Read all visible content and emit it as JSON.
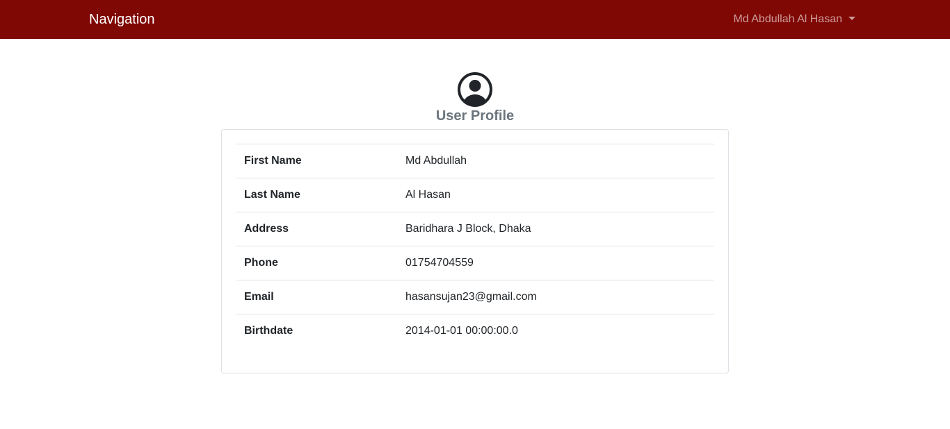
{
  "navbar": {
    "brand": "Navigation",
    "user_menu": "Md Abdullah Al Hasan",
    "background": "#7f0704"
  },
  "profile": {
    "icon": "user-circle-icon",
    "title": "User Profile",
    "rows": [
      {
        "label": "First Name",
        "value": "Md Abdullah"
      },
      {
        "label": "Last Name",
        "value": "Al Hasan"
      },
      {
        "label": "Address",
        "value": "Baridhara J Block, Dhaka"
      },
      {
        "label": "Phone",
        "value": "01754704559"
      },
      {
        "label": "Email",
        "value": "hasansujan23@gmail.com"
      },
      {
        "label": "Birthdate",
        "value": "2014-01-01 00:00:00.0"
      }
    ]
  }
}
